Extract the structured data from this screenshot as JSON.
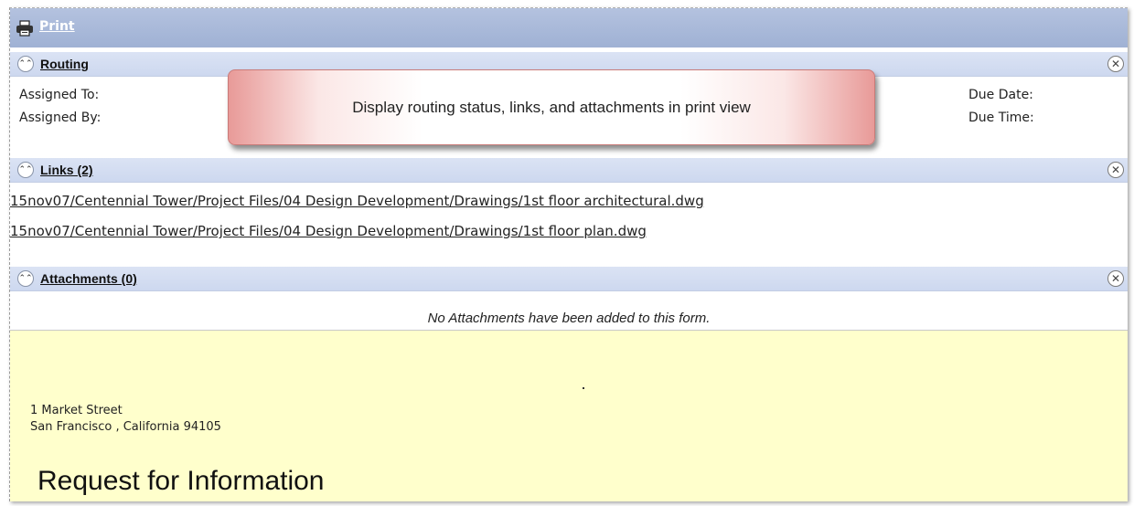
{
  "toolbar": {
    "print_label": "Print"
  },
  "routing": {
    "title": "Routing",
    "assigned_to_label": "Assigned To:",
    "assigned_by_label": "Assigned By:",
    "due_date_label": "Due Date:",
    "due_time_label": "Due Time:"
  },
  "callout": {
    "text": "Display routing status, links, and attachments in print view"
  },
  "links": {
    "title": "Links (2)",
    "items": [
      "15nov07/Centennial Tower/Project Files/04 Design Development/Drawings/1st floor architectural.dwg",
      "15nov07/Centennial Tower/Project Files/04 Design Development/Drawings/1st floor plan.dwg"
    ]
  },
  "attachments": {
    "title": "Attachments (0)",
    "empty_message": "No Attachments have been added to this form."
  },
  "form": {
    "address_line1": "1 Market Street",
    "address_line2": "San Francisco , California 94105",
    "title": "Request for Information"
  },
  "icons": {
    "print": "printer-icon",
    "collapse": "collapse-up-icon",
    "close": "close-icon"
  },
  "colors": {
    "header_bar": "#a9b9d9",
    "section_header": "#d4ddf2",
    "form_background": "#ffffcc",
    "callout_accent": "#e89a98"
  }
}
